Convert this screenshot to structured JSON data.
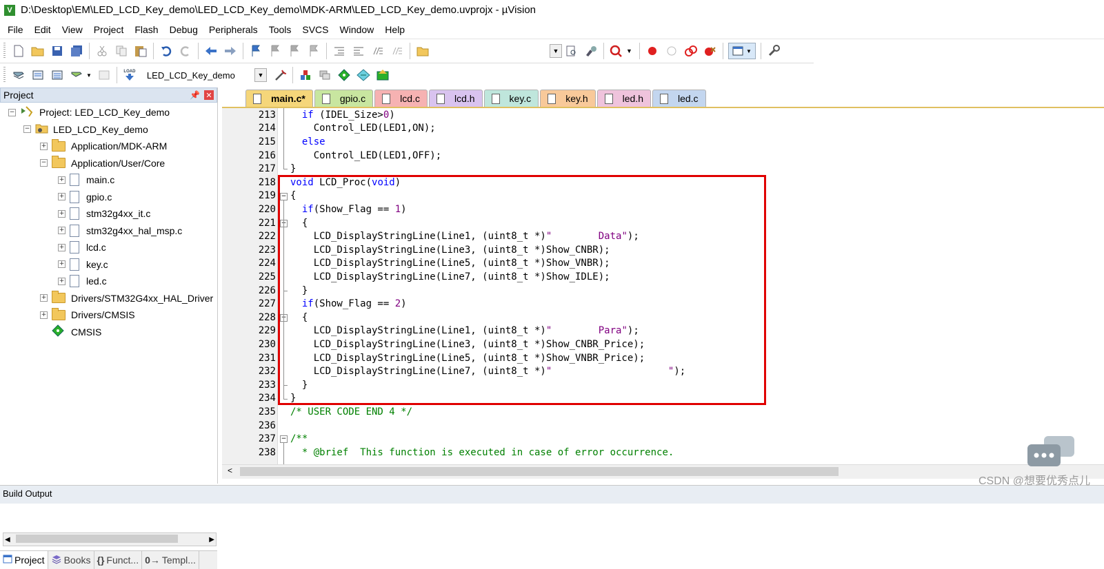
{
  "window": {
    "title": "D:\\Desktop\\EM\\LED_LCD_Key_demo\\LED_LCD_Key_demo\\MDK-ARM\\LED_LCD_Key_demo.uvprojx - µVision",
    "icon_label": "V"
  },
  "menu": [
    "File",
    "Edit",
    "View",
    "Project",
    "Flash",
    "Debug",
    "Peripherals",
    "Tools",
    "SVCS",
    "Window",
    "Help"
  ],
  "toolbar2": {
    "target": "LED_LCD_Key_demo",
    "load_label": "LOAD"
  },
  "project_pane": {
    "title": "Project",
    "tree": [
      {
        "label": "Project: LED_LCD_Key_demo",
        "level": 0,
        "type": "project",
        "expander": "−"
      },
      {
        "label": "LED_LCD_Key_demo",
        "level": 1,
        "type": "target",
        "expander": "−"
      },
      {
        "label": "Application/MDK-ARM",
        "level": 2,
        "type": "folder",
        "expander": "+"
      },
      {
        "label": "Application/User/Core",
        "level": 2,
        "type": "folder",
        "expander": "−"
      },
      {
        "label": "main.c",
        "level": 3,
        "type": "file",
        "expander": "+"
      },
      {
        "label": "gpio.c",
        "level": 3,
        "type": "file",
        "expander": "+"
      },
      {
        "label": "stm32g4xx_it.c",
        "level": 3,
        "type": "file",
        "expander": "+"
      },
      {
        "label": "stm32g4xx_hal_msp.c",
        "level": 3,
        "type": "file",
        "expander": "+"
      },
      {
        "label": "lcd.c",
        "level": 3,
        "type": "file",
        "expander": "+"
      },
      {
        "label": "key.c",
        "level": 3,
        "type": "file",
        "expander": "+"
      },
      {
        "label": "led.c",
        "level": 3,
        "type": "file",
        "expander": "+"
      },
      {
        "label": "Drivers/STM32G4xx_HAL_Driver",
        "level": 2,
        "type": "folder",
        "expander": "+"
      },
      {
        "label": "Drivers/CMSIS",
        "level": 2,
        "type": "folder",
        "expander": "+"
      },
      {
        "label": "CMSIS",
        "level": 2,
        "type": "component",
        "expander": ""
      }
    ],
    "tabs": [
      "Project",
      "Books",
      "Funct...",
      "Templ..."
    ],
    "tab_icons": [
      "",
      "",
      "{}",
      "0→"
    ]
  },
  "editor": {
    "tabs": [
      {
        "label": "main.c*",
        "color": "#f5d67a",
        "active": true
      },
      {
        "label": "gpio.c",
        "color": "#c8e6a0"
      },
      {
        "label": "lcd.c",
        "color": "#f6b2b2"
      },
      {
        "label": "lcd.h",
        "color": "#d9c3ef"
      },
      {
        "label": "key.c",
        "color": "#bfe6dc"
      },
      {
        "label": "key.h",
        "color": "#f8c99a"
      },
      {
        "label": "led.h",
        "color": "#efc3dc"
      },
      {
        "label": "led.c",
        "color": "#c3d6ef"
      }
    ],
    "lines": [
      {
        "no": "213",
        "fold": "",
        "text": "  if (IDEL_Size>0)"
      },
      {
        "no": "214",
        "fold": "",
        "text": "    Control_LED(LED1,ON);"
      },
      {
        "no": "215",
        "fold": "",
        "text": "  else"
      },
      {
        "no": "216",
        "fold": "",
        "text": "    Control_LED(LED1,OFF);"
      },
      {
        "no": "217",
        "fold": "end",
        "text": "}"
      },
      {
        "no": "218",
        "fold": "",
        "text": "void LCD_Proc(void)"
      },
      {
        "no": "219",
        "fold": "−",
        "text": "{"
      },
      {
        "no": "220",
        "fold": "",
        "text": "  if(Show_Flag == 1)"
      },
      {
        "no": "221",
        "fold": "−",
        "text": "  {"
      },
      {
        "no": "222",
        "fold": "",
        "text": "    LCD_DisplayStringLine(Line1, (uint8_t *)\"        Data\");"
      },
      {
        "no": "223",
        "fold": "",
        "text": "    LCD_DisplayStringLine(Line3, (uint8_t *)Show_CNBR);"
      },
      {
        "no": "224",
        "fold": "",
        "text": "    LCD_DisplayStringLine(Line5, (uint8_t *)Show_VNBR);"
      },
      {
        "no": "225",
        "fold": "",
        "text": "    LCD_DisplayStringLine(Line7, (uint8_t *)Show_IDLE);"
      },
      {
        "no": "226",
        "fold": "tick",
        "text": "  }"
      },
      {
        "no": "227",
        "fold": "",
        "text": "  if(Show_Flag == 2)"
      },
      {
        "no": "228",
        "fold": "−",
        "text": "  {"
      },
      {
        "no": "229",
        "fold": "",
        "text": "    LCD_DisplayStringLine(Line1, (uint8_t *)\"        Para\");"
      },
      {
        "no": "230",
        "fold": "",
        "text": "    LCD_DisplayStringLine(Line3, (uint8_t *)Show_CNBR_Price);"
      },
      {
        "no": "231",
        "fold": "",
        "text": "    LCD_DisplayStringLine(Line5, (uint8_t *)Show_VNBR_Price);"
      },
      {
        "no": "232",
        "fold": "",
        "text": "    LCD_DisplayStringLine(Line7, (uint8_t *)\"                    \");"
      },
      {
        "no": "233",
        "fold": "tick",
        "text": "  }"
      },
      {
        "no": "234",
        "fold": "end",
        "text": "}"
      },
      {
        "no": "235",
        "fold": "",
        "text": "/* USER CODE END 4 */"
      },
      {
        "no": "236",
        "fold": "",
        "text": ""
      },
      {
        "no": "237",
        "fold": "−",
        "text": "/**"
      },
      {
        "no": "238",
        "fold": "",
        "text": "  * @brief  This function is executed in case of error occurrence."
      }
    ]
  },
  "build_output": {
    "title": "Build Output"
  },
  "watermark": "CSDN @想要优秀点儿"
}
